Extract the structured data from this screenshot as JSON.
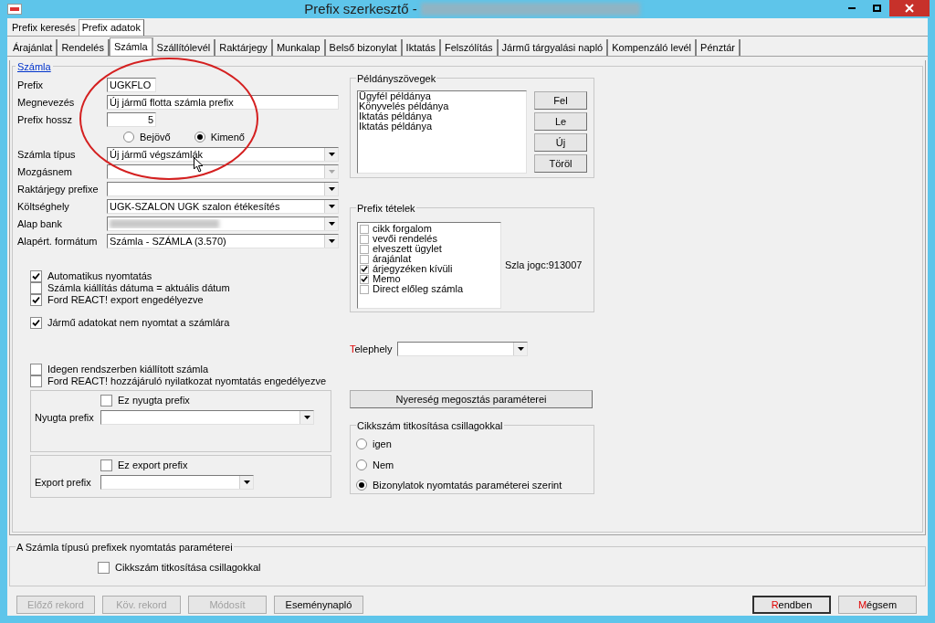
{
  "window": {
    "title": "Prefix szerkesztő -"
  },
  "outer_tabs": [
    {
      "label": "Prefix keresés",
      "selected": false
    },
    {
      "label": "Prefix adatok",
      "selected": true
    }
  ],
  "tabs": [
    {
      "label": "Árajánlat",
      "selected": false
    },
    {
      "label": "Rendelés",
      "selected": false
    },
    {
      "label": "Számla",
      "selected": true
    },
    {
      "label": "Szállítólevél",
      "selected": false
    },
    {
      "label": "Raktárjegy",
      "selected": false
    },
    {
      "label": "Munkalap",
      "selected": false
    },
    {
      "label": "Belső bizonylat",
      "selected": false
    },
    {
      "label": "Iktatás",
      "selected": false
    },
    {
      "label": "Felszólítás",
      "selected": false
    },
    {
      "label": "Jármű tárgyalási napló",
      "selected": false
    },
    {
      "label": "Kompenzáló levél",
      "selected": false
    },
    {
      "label": "Pénztár",
      "selected": false
    }
  ],
  "group_title": "Számla",
  "fields": [
    {
      "kind": "short_text",
      "label": "Prefix",
      "value": "UGKFLO"
    },
    {
      "kind": "text",
      "label": "Megnevezés",
      "value": "Új jármű flotta számla prefix"
    },
    {
      "kind": "number",
      "label": "Prefix hossz",
      "value": "5"
    },
    {
      "kind": "radios",
      "options": [
        {
          "label": "Bejövő",
          "selected": false
        },
        {
          "label": "Kimenő",
          "selected": true
        }
      ]
    },
    {
      "kind": "combo",
      "label": "Számla típus",
      "value": "Új jármű végszámlák",
      "disabled": false
    },
    {
      "kind": "combo",
      "label": "Mozgásnem",
      "disabled": true
    },
    {
      "kind": "combo",
      "label": "Raktárjegy prefixe",
      "disabled": false
    },
    {
      "kind": "combo",
      "label": "Költséghely",
      "value": "UGK-SZALON UGK szalon étékesítés",
      "disabled": false
    },
    {
      "kind": "combo",
      "label": "Alap bank",
      "redacted": true,
      "disabled": false
    },
    {
      "kind": "combo",
      "label": "Alapért. formátum",
      "value": "Számla - SZÁMLA (3.570)",
      "disabled": false
    }
  ],
  "checkbox_groups": [
    {
      "items": [
        {
          "label": "Automatikus nyomtatás",
          "checked": true
        },
        {
          "label": "Számla kiállítás dátuma = aktuális dátum",
          "checked": false
        },
        {
          "label": "Ford REACT! export engedélyezve",
          "checked": true
        }
      ]
    },
    {
      "items": [
        {
          "label": "Jármű adatokat nem nyomtat a számlára",
          "checked": true
        }
      ]
    },
    {
      "items": [
        {
          "label": "Idegen rendszerben kiállított számla",
          "checked": false
        },
        {
          "label": "Ford REACT! hozzájáruló nyilatkozat nyomtatás engedélyezve",
          "checked": false
        }
      ]
    }
  ],
  "prefix_boxes": [
    {
      "checkbox": {
        "label": "Ez nyugta prefix",
        "checked": false
      },
      "label": "Nyugta prefix",
      "kind": "wide"
    },
    {
      "checkbox": {
        "label": "Ez export prefix",
        "checked": false
      },
      "label": "Export prefix",
      "kind": "narrow"
    }
  ],
  "copies": {
    "title": "Példányszövegek",
    "items": [
      "Ügyfél példánya",
      "Könyvelés példánya",
      "Iktatás példánya",
      "Iktatás példánya"
    ],
    "buttons": [
      "Fel",
      "Le",
      "Új",
      "Töröl"
    ]
  },
  "prefix_items": {
    "title": "Prefix tételek",
    "items": [
      {
        "label": "cikk forgalom",
        "checked": false
      },
      {
        "label": "vevői rendelés",
        "checked": false
      },
      {
        "label": "elveszett ügylet",
        "checked": false
      },
      {
        "label": "árajánlat",
        "checked": false
      },
      {
        "label": "árjegyzéken kívüli",
        "checked": true
      },
      {
        "label": "Memo",
        "checked": true
      },
      {
        "label": "Direct előleg számla",
        "checked": false
      }
    ],
    "note": "Szla jogc:913007"
  },
  "site": {
    "label": "Telephely",
    "accelerator": true
  },
  "profit_button": "Nyereség megosztás paraméterei",
  "masking": {
    "title": "Cikkszám titkosítása csillagokkal",
    "options": [
      {
        "label": "igen",
        "selected": false
      },
      {
        "label": "Nem",
        "selected": false
      },
      {
        "label": "Bizonylatok nyomtatás paraméterei szerint",
        "selected": true
      }
    ]
  },
  "print_params": {
    "title": "A Számla típusú prefixek nyomtatás paraméterei",
    "checkbox": {
      "label": "Cikkszám titkosítása csillagokkal",
      "checked": false
    }
  },
  "footer_buttons": [
    {
      "label": "Előző rekord",
      "disabled": true,
      "default": false,
      "accelerator": false
    },
    {
      "label": "Köv. rekord",
      "disabled": true,
      "default": false,
      "accelerator": false
    },
    {
      "label": "Módosít",
      "disabled": true,
      "default": false,
      "accelerator": false
    },
    {
      "label": "Eseménynapló",
      "disabled": false,
      "default": false,
      "accelerator": false
    },
    {
      "label": "Rendben",
      "disabled": false,
      "default": true,
      "accelerator": true
    },
    {
      "label": "Mégsem",
      "disabled": false,
      "default": false,
      "accelerator": true
    }
  ]
}
